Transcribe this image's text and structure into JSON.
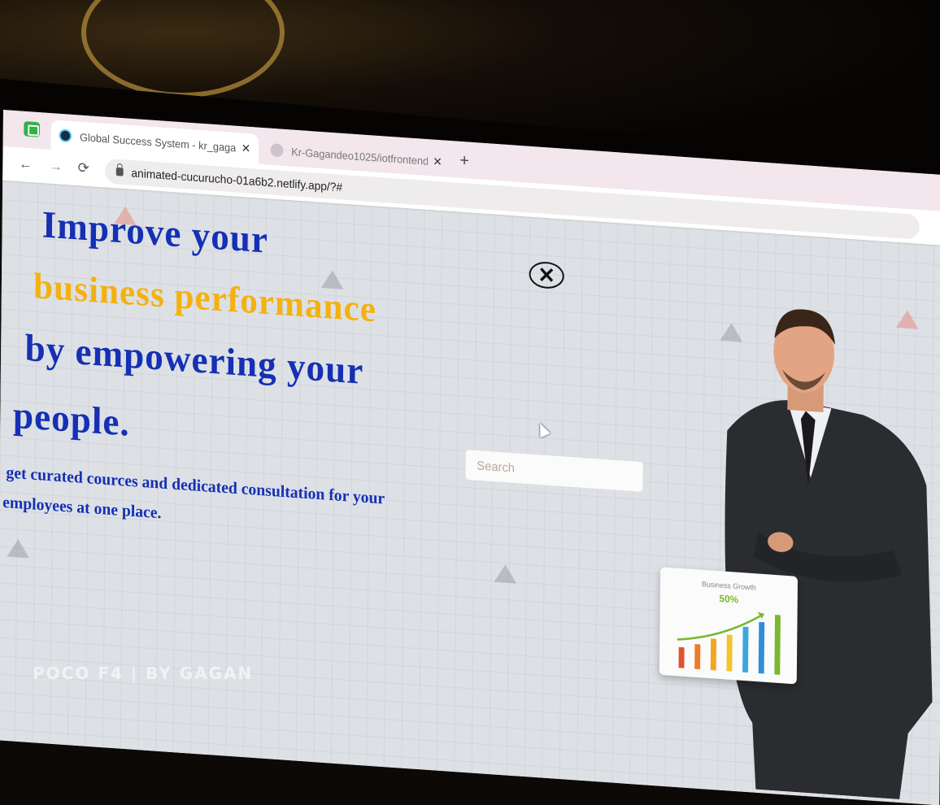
{
  "browser": {
    "tabs": [
      {
        "title": "Global Success System - kr_gagan",
        "close": "✕",
        "active": true
      },
      {
        "title": "Kr-Gagandeo1025/iotfrontend: th",
        "close": "✕",
        "active": false
      }
    ],
    "new_tab": "+",
    "nav": {
      "back": "←",
      "forward": "→",
      "reload": "⟳"
    },
    "url": "animated-cucurucho-01a6b2.netlify.app/?#",
    "extensions": [
      "⇪",
      "☆",
      "🐾",
      "🦊",
      "✦",
      "⤓"
    ]
  },
  "hero": {
    "line1": "Improve your",
    "line2": "business performance",
    "line3": "by empowering your",
    "line4": "people.",
    "sub1": "get curated cources and dedicated consultation for your",
    "sub2": "employees at one place."
  },
  "overlay": {
    "close_symbol": "✕"
  },
  "search": {
    "placeholder": "Search"
  },
  "growth_card": {
    "title": "Business Growth",
    "value": "50%"
  },
  "watermark": "POCO F4 | BY GAGAN",
  "colors": {
    "heading_blue": "#1530b4",
    "heading_gold": "#f4b10f",
    "growth_green": "#7cb82f"
  }
}
